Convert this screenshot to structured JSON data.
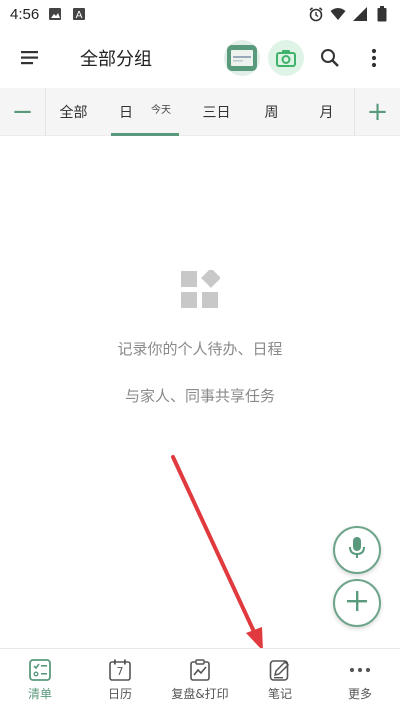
{
  "status_bar": {
    "time": "4:56",
    "left_icons": [
      "image-icon",
      "a-letter-icon"
    ],
    "right_icons": [
      "alarm-icon",
      "wifi-icon",
      "signal-icon",
      "battery-icon"
    ]
  },
  "app_bar": {
    "title": "全部分组",
    "menu_icon": "hamburger-menu-icon",
    "actions": [
      "scan-card-icon",
      "camera-icon",
      "search-icon",
      "more-vertical-icon"
    ]
  },
  "tabs": {
    "minus": "−",
    "plus": "+",
    "items": [
      "全部",
      "日",
      "三日",
      "周",
      "月"
    ],
    "active_index": 1,
    "today_label": "今天"
  },
  "empty_state": {
    "icon": "widgets-icon",
    "line1": "记录你的个人待办、日程",
    "line2": "与家人、同事共享任务"
  },
  "fabs": {
    "mic_icon": "microphone-icon",
    "add_icon": "plus-icon"
  },
  "bottom_nav": {
    "items": [
      {
        "label": "清单",
        "icon": "checklist-icon"
      },
      {
        "label": "日历",
        "icon": "calendar-icon",
        "icon_text": "7"
      },
      {
        "label": "复盘&打印",
        "icon": "clipboard-chart-icon"
      },
      {
        "label": "笔记",
        "icon": "note-edit-icon"
      },
      {
        "label": "更多",
        "icon": "more-horizontal-icon"
      }
    ],
    "active_index": 0
  },
  "colors": {
    "accent": "#5a9a7c",
    "annotation_arrow": "#e0393e",
    "empty_text": "#8a8a8a"
  }
}
